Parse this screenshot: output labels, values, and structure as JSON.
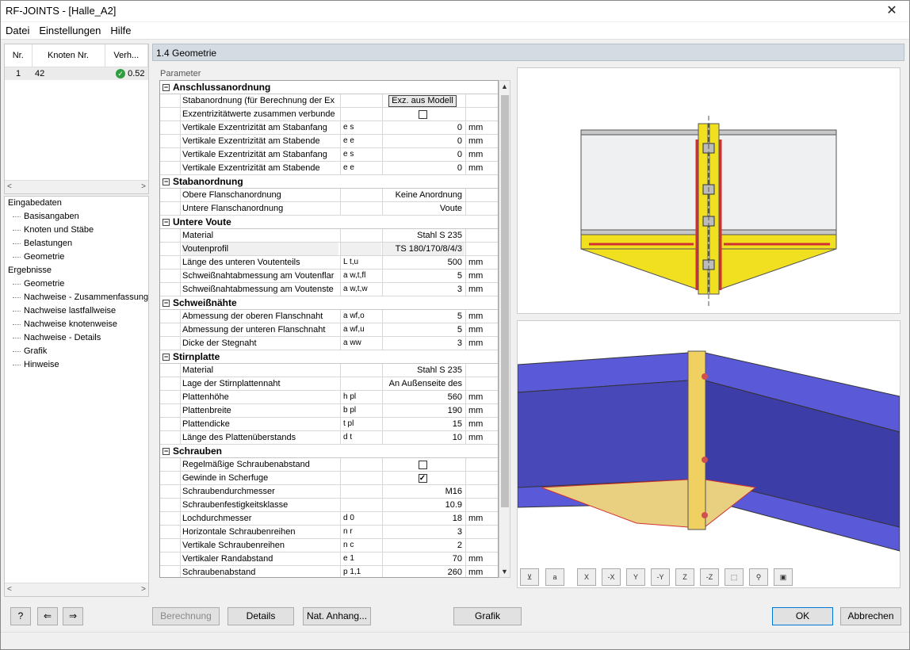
{
  "window": {
    "title": "RF-JOINTS - [Halle_A2]",
    "close": "✕"
  },
  "menu": [
    "Datei",
    "Einstellungen",
    "Hilfe"
  ],
  "nodes_table": {
    "headers": [
      "Nr.",
      "Knoten Nr.",
      "Verh..."
    ],
    "rows": [
      {
        "nr": "1",
        "knoten": "42",
        "ratio": "0.52"
      }
    ]
  },
  "nav": {
    "groups": [
      {
        "label": "Eingabedaten",
        "items": [
          "Basisangaben",
          "Knoten und Stäbe",
          "Belastungen",
          "Geometrie"
        ]
      },
      {
        "label": "Ergebnisse",
        "items": [
          "Geometrie",
          "Nachweise - Zusammenfassung",
          "Nachweise lastfallweise",
          "Nachweise knotenweise",
          "Nachweise - Details",
          "Grafik",
          "Hinweise"
        ]
      }
    ]
  },
  "section_title": "1.4 Geometrie",
  "param_label": "Parameter",
  "groups": [
    {
      "title": "Anschlussanordnung",
      "rows": [
        {
          "label": "Stabanordnung (für Berechnung der Ex",
          "sym": "",
          "value": "Exz. aus Modell",
          "unit": "",
          "kind": "button"
        },
        {
          "label": "Exzentrizitätwerte zusammen verbunde",
          "sym": "",
          "value": "",
          "unit": "",
          "kind": "check",
          "checked": false
        },
        {
          "label": "Vertikale Exzentrizität am Stabanfang",
          "sym": "e s",
          "value": "0",
          "unit": "mm"
        },
        {
          "label": "Vertikale Exzentrizität am Stabende",
          "sym": "e e",
          "value": "0",
          "unit": "mm"
        },
        {
          "label": "Vertikale Exzentrizität am Stabanfang",
          "sym": "e s",
          "value": "0",
          "unit": "mm"
        },
        {
          "label": "Vertikale Exzentrizität am Stabende",
          "sym": "e e",
          "value": "0",
          "unit": "mm"
        }
      ]
    },
    {
      "title": "Stabanordnung",
      "rows": [
        {
          "label": "Obere Flanschanordnung",
          "sym": "",
          "value": "Keine Anordnung",
          "unit": ""
        },
        {
          "label": "Untere Flanschanordnung",
          "sym": "",
          "value": "Voute",
          "unit": ""
        }
      ]
    },
    {
      "title": "Untere Voute",
      "rows": [
        {
          "label": "Material",
          "sym": "",
          "value": "Stahl S 235",
          "unit": ""
        },
        {
          "label": "Voutenprofil",
          "sym": "",
          "value": "TS 180/170/8/4/3",
          "unit": "",
          "highlight": true
        },
        {
          "label": "Länge des unteren Voutenteils",
          "sym": "L t,u",
          "value": "500",
          "unit": "mm"
        },
        {
          "label": "Schweißnahtabmessung am Voutenflar",
          "sym": "a w,t,fl",
          "value": "5",
          "unit": "mm"
        },
        {
          "label": "Schweißnahtabmessung am Voutenste",
          "sym": "a w,t,w",
          "value": "3",
          "unit": "mm"
        }
      ]
    },
    {
      "title": "Schweißnähte",
      "rows": [
        {
          "label": "Abmessung der oberen Flanschnaht",
          "sym": "a wf,o",
          "value": "5",
          "unit": "mm"
        },
        {
          "label": "Abmessung der unteren Flanschnaht",
          "sym": "a wf,u",
          "value": "5",
          "unit": "mm"
        },
        {
          "label": "Dicke der Stegnaht",
          "sym": "a ww",
          "value": "3",
          "unit": "mm"
        }
      ]
    },
    {
      "title": "Stirnplatte",
      "rows": [
        {
          "label": "Material",
          "sym": "",
          "value": "Stahl S 235",
          "unit": ""
        },
        {
          "label": "Lage der Stirnplattennaht",
          "sym": "",
          "value": "An Außenseite des",
          "unit": ""
        },
        {
          "label": "Plattenhöhe",
          "sym": "h pl",
          "value": "560",
          "unit": "mm"
        },
        {
          "label": "Plattenbreite",
          "sym": "b pl",
          "value": "190",
          "unit": "mm"
        },
        {
          "label": "Plattendicke",
          "sym": "t pl",
          "value": "15",
          "unit": "mm"
        },
        {
          "label": "Länge des Plattenüberstands",
          "sym": "d t",
          "value": "10",
          "unit": "mm"
        }
      ]
    },
    {
      "title": "Schrauben",
      "rows": [
        {
          "label": "Regelmäßige Schraubenabstand",
          "sym": "",
          "value": "",
          "unit": "",
          "kind": "check",
          "checked": false
        },
        {
          "label": "Gewinde in Scherfuge",
          "sym": "",
          "value": "",
          "unit": "",
          "kind": "check",
          "checked": true
        },
        {
          "label": "Schraubendurchmesser",
          "sym": "",
          "value": "M16",
          "unit": ""
        },
        {
          "label": "Schraubenfestigkeitsklasse",
          "sym": "",
          "value": "10.9",
          "unit": ""
        },
        {
          "label": "Lochdurchmesser",
          "sym": "d 0",
          "value": "18",
          "unit": "mm"
        },
        {
          "label": "Horizontale Schraubenreihen",
          "sym": "n r",
          "value": "3",
          "unit": ""
        },
        {
          "label": "Vertikale Schraubenreihen",
          "sym": "n c",
          "value": "2",
          "unit": ""
        },
        {
          "label": "Vertikaler Randabstand",
          "sym": "e 1",
          "value": "70",
          "unit": "mm"
        },
        {
          "label": "Schraubenabstand",
          "sym": "p 1,1",
          "value": "260",
          "unit": "mm"
        }
      ]
    }
  ],
  "view_toolbar": [
    "X",
    "-X",
    "Y",
    "-Y",
    "Z",
    "-Z"
  ],
  "buttons": {
    "berechnung": "Berechnung",
    "details": "Details",
    "nat_anhang": "Nat. Anhang...",
    "grafik": "Grafik",
    "ok": "OK",
    "abbrechen": "Abbrechen"
  }
}
